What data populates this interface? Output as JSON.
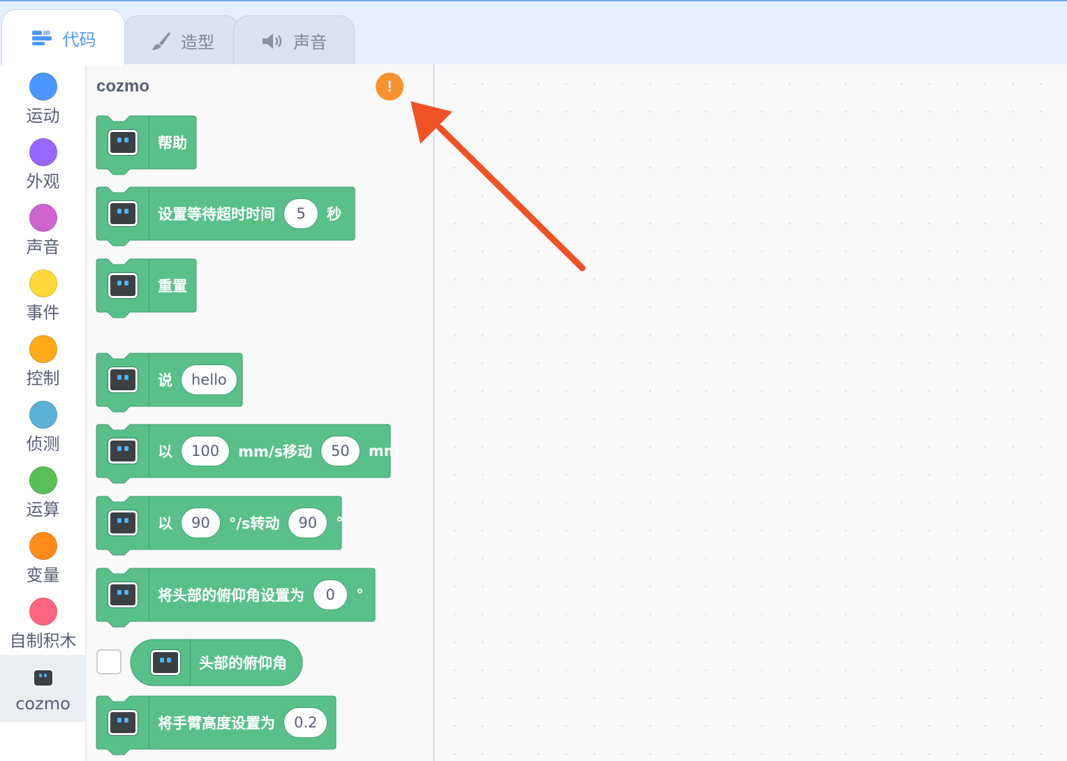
{
  "tabs": [
    {
      "label": "代码",
      "icon": "code-blocks-icon",
      "active": true
    },
    {
      "label": "造型",
      "icon": "paintbrush-icon",
      "active": false
    },
    {
      "label": "声音",
      "icon": "speaker-icon",
      "active": false
    }
  ],
  "categories": [
    {
      "label": "运动",
      "color": "#4c97ff"
    },
    {
      "label": "外观",
      "color": "#9966ff"
    },
    {
      "label": "声音",
      "color": "#cf63cf"
    },
    {
      "label": "事件",
      "color": "#ffd939"
    },
    {
      "label": "控制",
      "color": "#ffab19"
    },
    {
      "label": "侦测",
      "color": "#5cb1d6"
    },
    {
      "label": "运算",
      "color": "#59c059"
    },
    {
      "label": "变量",
      "color": "#ff8c1a"
    },
    {
      "label": "自制积木",
      "color": "#ff6680"
    },
    {
      "label": "cozmo",
      "icon": "cozmo-robot-icon",
      "selected": true
    }
  ],
  "flyout": {
    "title": "cozmo",
    "warning_icon": "exclamation-icon",
    "block_color": "#59c08a"
  },
  "blocks": {
    "help": {
      "label": "帮助"
    },
    "timeout": {
      "label": "设置等待超时时间",
      "value": "5",
      "unit": "秒"
    },
    "reset": {
      "label": "重置"
    },
    "say": {
      "label": "说",
      "value": "hello"
    },
    "move": {
      "prefix": "以",
      "speed": "100",
      "mid": "mm/s移动",
      "distance": "50",
      "unit": "mm"
    },
    "turn": {
      "prefix": "以",
      "speed": "90",
      "mid": "°/s转动",
      "angle": "90",
      "unit": "°"
    },
    "head_angle": {
      "label": "将头部的俯仰角设置为",
      "value": "0",
      "unit": "°"
    },
    "head_reporter": {
      "label": "头部的俯仰角"
    },
    "lift": {
      "label": "将手臂高度设置为",
      "value": "0.2"
    }
  },
  "annotation": {
    "color": "#ee5225"
  }
}
